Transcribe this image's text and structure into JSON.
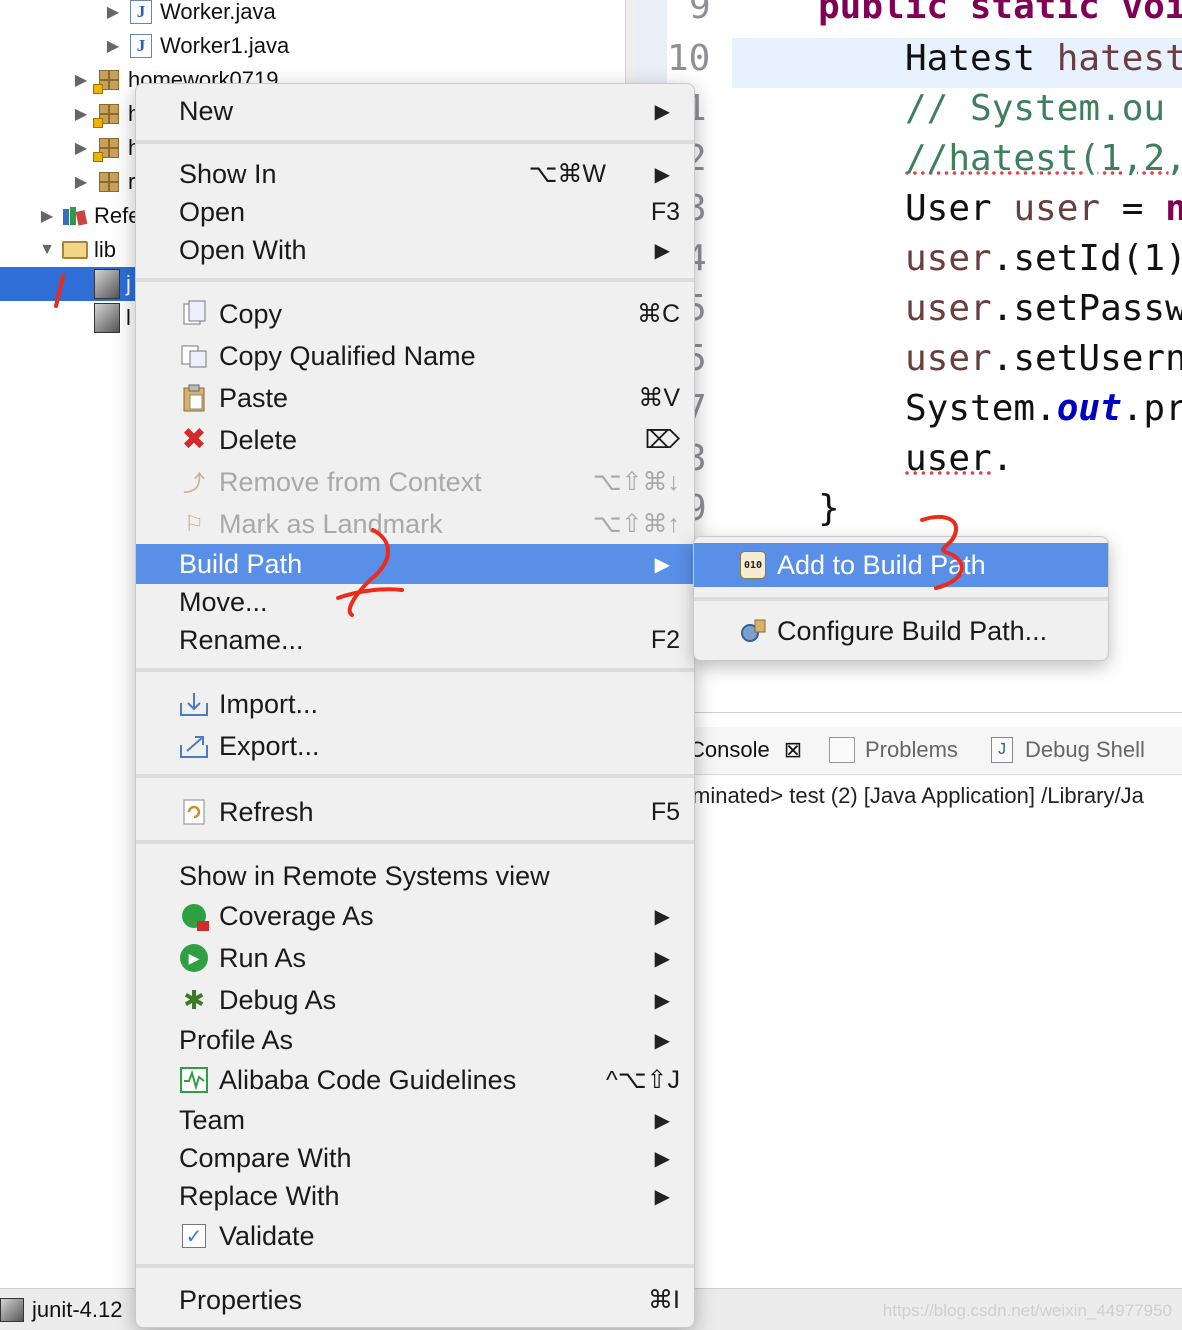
{
  "tree": {
    "rows": [
      {
        "label": "Worker.java",
        "icon": "java-file-icon"
      },
      {
        "label": "Worker1.java",
        "icon": "java-file-icon"
      },
      {
        "label": "homework0719",
        "icon": "package-icon"
      },
      {
        "label": "h",
        "icon": "package-icon"
      },
      {
        "label": "h",
        "icon": "package-icon"
      },
      {
        "label": "r",
        "icon": "package-icon"
      },
      {
        "label": "Refe",
        "icon": "referenced-libraries-icon"
      },
      {
        "label": "lib",
        "icon": "folder-icon"
      },
      {
        "label": "j",
        "icon": "jar-icon"
      },
      {
        "label": "l",
        "icon": "jar-icon"
      }
    ]
  },
  "editor": {
    "line_numbers": [
      "9",
      "10",
      "1",
      "2",
      "3",
      "4",
      "5",
      "5",
      "7",
      "3",
      "9"
    ],
    "lines": [
      {
        "parts": [
          {
            "t": "public static voi",
            "c": "kw"
          }
        ]
      },
      {
        "parts": [
          {
            "t": "Hatest ",
            "c": ""
          },
          {
            "t": "hatest",
            "c": "var"
          }
        ]
      },
      {
        "parts": [
          {
            "t": "//  System.ou",
            "c": "cm"
          }
        ]
      },
      {
        "parts": [
          {
            "t": "//hatest(1,2,",
            "c": "cm"
          }
        ]
      },
      {
        "parts": [
          {
            "t": "User ",
            "c": ""
          },
          {
            "t": "user",
            "c": "var"
          },
          {
            "t": " = ",
            "c": ""
          },
          {
            "t": "n",
            "c": "kw"
          }
        ]
      },
      {
        "parts": [
          {
            "t": "user",
            "c": "var"
          },
          {
            "t": ".setId(1)",
            "c": ""
          }
        ]
      },
      {
        "parts": [
          {
            "t": "user",
            "c": "var"
          },
          {
            "t": ".setPassw",
            "c": ""
          }
        ]
      },
      {
        "parts": [
          {
            "t": "user",
            "c": "var"
          },
          {
            "t": ".setUsern",
            "c": ""
          }
        ]
      },
      {
        "parts": [
          {
            "t": "System.",
            "c": ""
          },
          {
            "t": "out",
            "c": "fld"
          },
          {
            "t": ".pr",
            "c": ""
          }
        ]
      },
      {
        "parts": [
          {
            "t": "user",
            "c": ""
          },
          {
            "t": ".",
            "c": ""
          }
        ]
      },
      {
        "parts": [
          {
            "t": "}",
            "c": ""
          }
        ]
      }
    ]
  },
  "console": {
    "tabs": [
      {
        "label": "Console",
        "close": "⊠"
      },
      {
        "label": "Problems"
      },
      {
        "label": "Debug Shell"
      }
    ],
    "line": "minated> test (2) [Java Application] /Library/Ja"
  },
  "status": {
    "item_label": "junit-4.12",
    "watermark": "https://blog.csdn.net/weixin_44977950"
  },
  "menu": {
    "items": [
      {
        "label": "New",
        "submenu": true
      },
      {
        "label": "Show In",
        "shortcut": "⌥⌘W",
        "submenu": true
      },
      {
        "label": "Open",
        "shortcut": "F3"
      },
      {
        "label": "Open With",
        "submenu": true
      },
      {
        "label": "Copy",
        "shortcut": "⌘C",
        "icon": "copy-icon"
      },
      {
        "label": "Copy Qualified Name",
        "icon": "copy-qualified-name-icon"
      },
      {
        "label": "Paste",
        "shortcut": "⌘V",
        "icon": "paste-icon"
      },
      {
        "label": "Delete",
        "shortcut": "⌦",
        "icon": "delete-icon"
      },
      {
        "label": "Remove from Context",
        "shortcut": "⌥⇧⌘↓",
        "icon": "remove-context-icon",
        "disabled": true
      },
      {
        "label": "Mark as Landmark",
        "shortcut": "⌥⇧⌘↑",
        "icon": "landmark-icon",
        "disabled": true
      },
      {
        "label": "Build Path",
        "submenu": true,
        "highlight": true
      },
      {
        "label": "Move..."
      },
      {
        "label": "Rename...",
        "shortcut": "F2"
      },
      {
        "label": "Import...",
        "icon": "import-icon"
      },
      {
        "label": "Export...",
        "icon": "export-icon"
      },
      {
        "label": "Refresh",
        "shortcut": "F5",
        "icon": "refresh-icon"
      },
      {
        "label": "Show in Remote Systems view"
      },
      {
        "label": "Coverage As",
        "submenu": true,
        "icon": "coverage-icon"
      },
      {
        "label": "Run As",
        "submenu": true,
        "icon": "run-icon"
      },
      {
        "label": "Debug As",
        "submenu": true,
        "icon": "debug-icon"
      },
      {
        "label": "Profile As",
        "submenu": true
      },
      {
        "label": "Alibaba Code Guidelines",
        "shortcut": "^⌥⇧J",
        "icon": "alibaba-guidelines-icon"
      },
      {
        "label": "Team",
        "submenu": true
      },
      {
        "label": "Compare With",
        "submenu": true
      },
      {
        "label": "Replace With",
        "submenu": true
      },
      {
        "label": "Validate",
        "icon": "validate-checkbox-icon"
      },
      {
        "label": "Properties",
        "shortcut": "⌘I"
      }
    ],
    "submenu_arrow": "▶"
  },
  "submenu": {
    "items": [
      {
        "label": "Add to Build Path",
        "icon": "add-to-build-path-icon",
        "highlight": true
      },
      {
        "label": "Configure Build Path...",
        "icon": "configure-build-path-icon"
      }
    ]
  },
  "annotations": {
    "marks": [
      "1",
      "2",
      "3"
    ],
    "color": "#ee2a1b"
  },
  "colors": {
    "selection": "#2f6ed6",
    "menu_highlight": "#5a8fe8",
    "keyword": "#7f0055",
    "comment": "#3f7f5f"
  }
}
